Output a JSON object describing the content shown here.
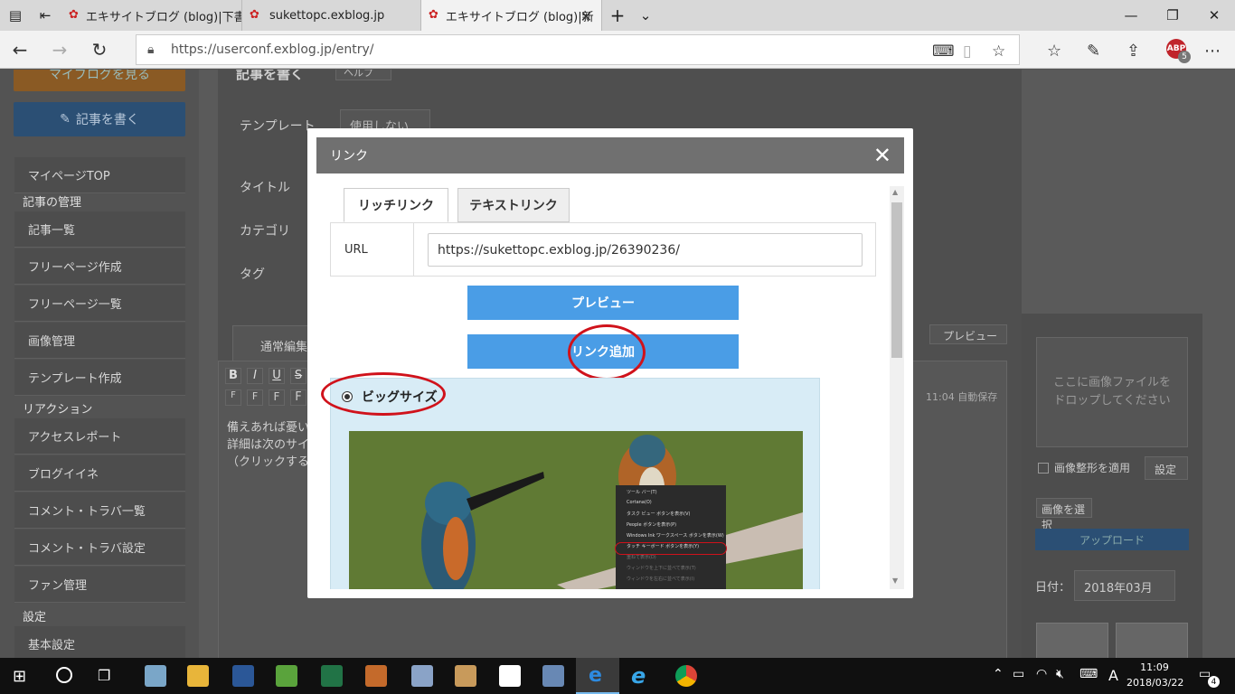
{
  "browser": {
    "tabs": [
      {
        "title": "エキサイトブログ (blog)|下書き"
      },
      {
        "title": "sukettopc.exblog.jp"
      },
      {
        "title": "エキサイトブログ (blog)|新"
      }
    ],
    "url": "https://userconf.exblog.jp/entry/",
    "abp_label": "ABP",
    "abp_count": "5"
  },
  "sidebar": {
    "my_blog_button": "マイブログを見る",
    "write_button": "記事を書く",
    "items": [
      {
        "label": "マイページTOP",
        "type": "item"
      },
      {
        "label": "記事の管理",
        "type": "head"
      },
      {
        "label": "記事一覧",
        "type": "item"
      },
      {
        "label": "フリーページ作成",
        "type": "item"
      },
      {
        "label": "フリーページ一覧",
        "type": "item"
      },
      {
        "label": "画像管理",
        "type": "item"
      },
      {
        "label": "テンプレート作成",
        "type": "item"
      },
      {
        "label": "リアクション",
        "type": "head"
      },
      {
        "label": "アクセスレポート",
        "type": "item"
      },
      {
        "label": "ブログイイネ",
        "type": "item"
      },
      {
        "label": "コメント・トラバ一覧",
        "type": "item"
      },
      {
        "label": "コメント・トラバ設定",
        "type": "item"
      },
      {
        "label": "ファン管理",
        "type": "item"
      },
      {
        "label": "設定",
        "type": "head"
      },
      {
        "label": "基本設定",
        "type": "item"
      }
    ]
  },
  "editor": {
    "heading": "記事を書く",
    "help": "ヘルプ",
    "template_label": "テンプレート",
    "template_value": "使用しない",
    "title_label": "タイトル",
    "category_label": "カテゴリ",
    "tag_label": "タグ",
    "tab_normal": "通常編集",
    "preview_button": "プレビュー",
    "autosave": "11:04 自動保存",
    "body_lines": [
      "備えあれば憂い",
      "詳細は次のサイ",
      "（クリックする"
    ],
    "toolbar_buttons": [
      "B",
      "I",
      "U",
      "S"
    ],
    "font_buttons": [
      "F",
      "F",
      "F",
      "F"
    ]
  },
  "rightpanel": {
    "drop_text": "ここに画像ファイルを\nドロップしてください",
    "img_format_label": "画像整形を適用",
    "settings_button": "設定",
    "select_image": "画像を選択",
    "upload": "アップロード",
    "date_label": "日付：",
    "date_value": "2018年03月"
  },
  "modal": {
    "title": "リンク",
    "tab_rich": "リッチリンク",
    "tab_text": "テキストリンク",
    "url_label": "URL",
    "url_value": "https://sukettopc.exblog.jp/26390236/",
    "preview_button": "プレビュー",
    "add_link_button": "リンク追加",
    "size_option": "ビッグサイズ",
    "context_menu": [
      "ツール バー(T)",
      "Cortana(O)",
      "タスク ビュー ボタンを表示(V)",
      "People ボタンを表示(P)",
      "Windows Ink ワークスペース ボタンを表示(W)",
      "タッチ キーボード ボタンを表示(Y)",
      "重ねて表示(D)",
      "ウィンドウを上下に並べて表示(T)",
      "ウィンドウを左右に並べて表示(I)"
    ]
  },
  "taskbar": {
    "time": "11:09",
    "date": "2018/03/22",
    "ime": "A",
    "notifications": "4"
  },
  "colors": {
    "accent_blue": "#4a9de6",
    "modal_header": "#707070",
    "annotation_red": "#d0121b",
    "preview_bg": "#d8ecf6"
  }
}
